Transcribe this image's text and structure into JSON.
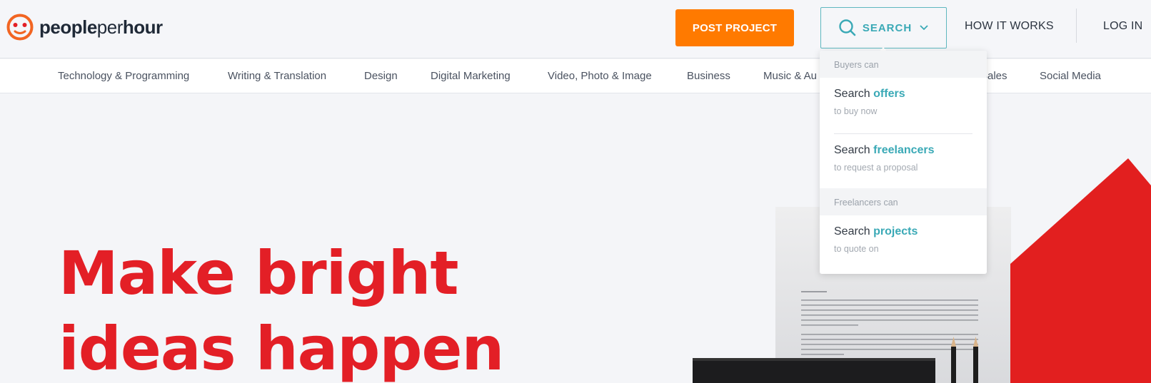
{
  "brand": {
    "logo_words": [
      "people",
      "per",
      "hour"
    ],
    "logo_color": "#f26522",
    "accent_color": "#3aa9b6",
    "cta_color": "#ff7a00",
    "hero_color": "#e31f26"
  },
  "header": {
    "post_project_label": "POST PROJECT",
    "search_label": "SEARCH",
    "how_it_works_label": "HOW IT WORKS",
    "login_label": "LOG IN",
    "icons": {
      "search": "search-icon",
      "caret": "chevron-down-icon"
    }
  },
  "categories": [
    "Technology & Programming",
    "Writing & Translation",
    "Design",
    "Digital Marketing",
    "Video, Photo & Image",
    "Business",
    "Music & Au",
    "Sales",
    "Social Media"
  ],
  "dropdown": {
    "buyers_heading": "Buyers can",
    "freelancers_heading": "Freelancers can",
    "items": [
      {
        "prefix": "Search ",
        "keyword": "offers",
        "sub": "to buy now"
      },
      {
        "prefix": "Search ",
        "keyword": "freelancers",
        "sub": "to request a proposal"
      },
      {
        "prefix": "Search ",
        "keyword": "projects",
        "sub": "to quote on"
      }
    ]
  },
  "hero": {
    "line1": "Make bright",
    "line2": "ideas happen"
  }
}
